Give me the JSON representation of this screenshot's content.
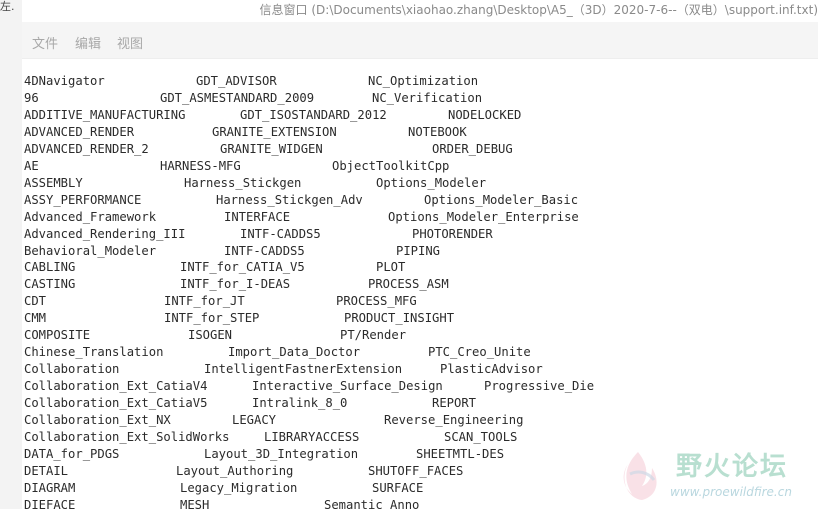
{
  "left_fragment": "左.",
  "window": {
    "title": "信息窗口 (D:\\Documents\\xiaohao.zhang\\Desktop\\A5_（3D）2020-7-6--（双电）\\support.inf.txt)"
  },
  "menu": [
    {
      "label": "文件"
    },
    {
      "label": "编辑"
    },
    {
      "label": "视图"
    }
  ],
  "rows": [
    [
      "4DNavigator",
      "GDT_ADVISOR",
      "NC_Optimization"
    ],
    [
      "96",
      "GDT_ASMESTANDARD_2009",
      "NC_Verification"
    ],
    [
      "ADDITIVE_MANUFACTURING",
      "GDT_ISOSTANDARD_2012",
      "NODELOCKED"
    ],
    [
      "ADVANCED_RENDER",
      "GRANITE_EXTENSION",
      "NOTEBOOK"
    ],
    [
      "ADVANCED_RENDER_2",
      "GRANITE_WIDGEN",
      "ORDER_DEBUG"
    ],
    [
      "AE",
      "HARNESS-MFG",
      "ObjectToolkitCpp"
    ],
    [
      "ASSEMBLY",
      "Harness_Stickgen",
      "Options_Modeler"
    ],
    [
      "ASSY_PERFORMANCE",
      "Harness_Stickgen_Adv",
      "Options_Modeler_Basic"
    ],
    [
      "Advanced_Framework",
      "INTERFACE",
      "Options_Modeler_Enterprise"
    ],
    [
      "Advanced_Rendering_III",
      "INTF-CADDS5",
      "PHOTORENDER"
    ],
    [
      "Behavioral_Modeler",
      "INTF-CADDS5",
      "PIPING"
    ],
    [
      "CABLING",
      "INTF_for_CATIA_V5",
      "PLOT"
    ],
    [
      "CASTING",
      "INTF_for_I-DEAS",
      "PROCESS_ASM"
    ],
    [
      "CDT",
      "INTF_for_JT",
      "PROCESS_MFG"
    ],
    [
      "CMM",
      "INTF_for_STEP",
      "PRODUCT_INSIGHT"
    ],
    [
      "COMPOSITE",
      "ISOGEN",
      "PT/Render"
    ],
    [
      "Chinese_Translation",
      "Import_Data_Doctor",
      "PTC_Creo_Unite"
    ],
    [
      "Collaboration",
      "IntelligentFastnerExtension",
      "PlasticAdvisor"
    ],
    [
      "Collaboration_Ext_CatiaV4",
      "Interactive_Surface_Design",
      "Progressive_Die"
    ],
    [
      "Collaboration_Ext_CatiaV5",
      "Intralink_8_0",
      "REPORT"
    ],
    [
      "Collaboration_Ext_NX",
      "LEGACY",
      "Reverse_Engineering"
    ],
    [
      "Collaboration_Ext_SolidWorks",
      "LIBRARYACCESS",
      "SCAN_TOOLS"
    ],
    [
      "DATA_for_PDGS",
      "Layout_3D_Integration",
      "SHEETMTL-DES"
    ],
    [
      "DETAIL",
      "Layout_Authoring",
      "SHUTOFF_FACES"
    ],
    [
      "DIAGRAM",
      "Legacy_Migration",
      "SURFACE"
    ],
    [
      "DIEFACE",
      "MESH",
      "Semantic_Anno"
    ]
  ],
  "watermark": {
    "title": "野火论坛",
    "url": "www.proewildfire.cn"
  }
}
